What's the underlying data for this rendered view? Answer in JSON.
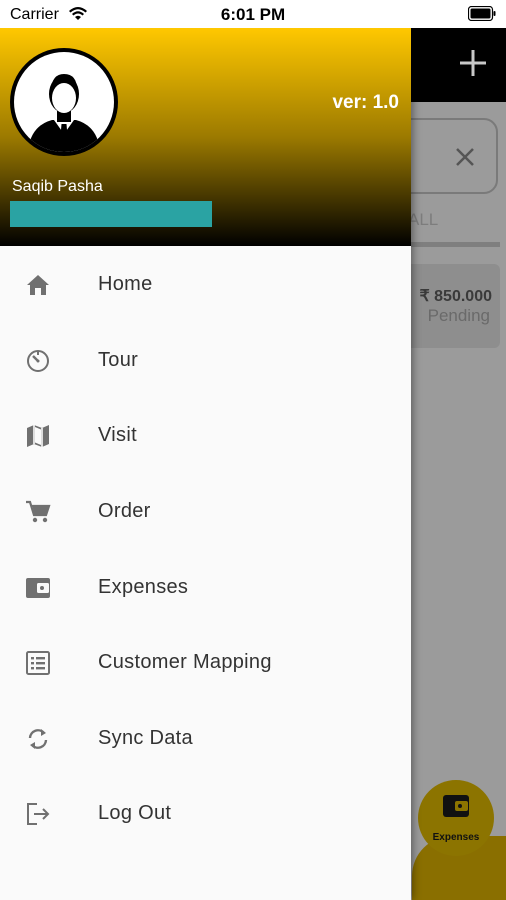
{
  "status_bar": {
    "carrier": "Carrier",
    "time": "6:01 PM"
  },
  "drawer": {
    "version": "ver: 1.0",
    "user_name": "Saqib Pasha",
    "menu": [
      {
        "label": "Home",
        "icon": "home-icon"
      },
      {
        "label": "Tour",
        "icon": "timer-icon"
      },
      {
        "label": "Visit",
        "icon": "map-icon"
      },
      {
        "label": "Order",
        "icon": "cart-icon"
      },
      {
        "label": "Expenses",
        "icon": "wallet-icon"
      },
      {
        "label": "Customer Mapping",
        "icon": "list-icon"
      },
      {
        "label": "Sync Data",
        "icon": "sync-icon"
      },
      {
        "label": "Log Out",
        "icon": "logout-icon"
      }
    ]
  },
  "background": {
    "tab_label": "ALL",
    "card_amount": "₹ 850.000",
    "card_status": "Pending",
    "fab_label": "Expenses"
  },
  "colors": {
    "accent": "#ffc800",
    "user_bar": "#2aa3a3",
    "icon_gray": "#707070"
  }
}
